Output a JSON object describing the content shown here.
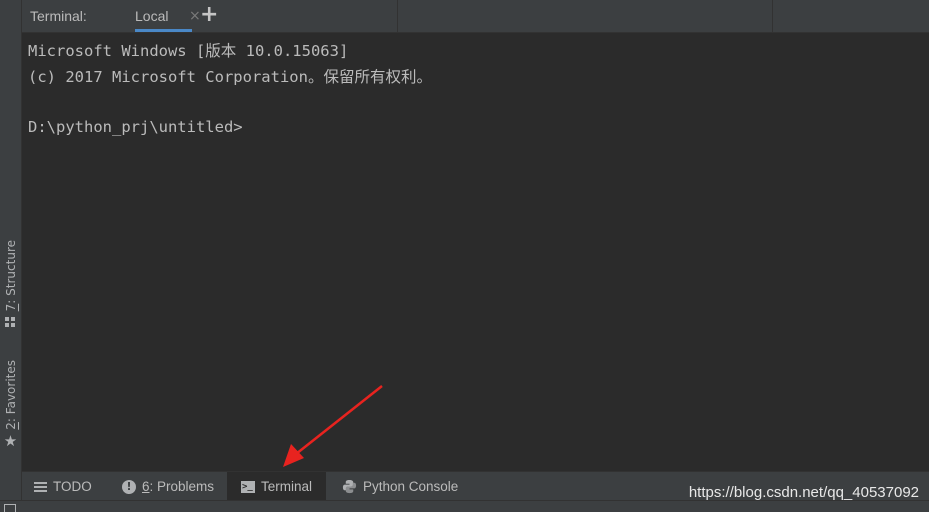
{
  "header": {
    "title": "Terminal:",
    "tabs": [
      {
        "label": "Local",
        "active": true
      }
    ],
    "close_glyph": "×",
    "add_glyph": "+"
  },
  "terminal": {
    "lines": [
      "Microsoft Windows [版本 10.0.15063]",
      "(c) 2017 Microsoft Corporation。保留所有权利。",
      "",
      "D:\\python_prj\\untitled>"
    ]
  },
  "left_stripe": {
    "structure": {
      "mnemonic": "7",
      "label": ": Structure"
    },
    "favorites": {
      "mnemonic": "2",
      "label": ": Favorites"
    }
  },
  "bottom_tabs": {
    "todo": "TODO",
    "problems_mnemonic": "6",
    "problems_label": ": Problems",
    "terminal": "Terminal",
    "python_console": "Python Console"
  },
  "watermark": "https://blog.csdn.net/qq_40537092",
  "colors": {
    "background": "#2b2b2b",
    "panel": "#3c3f41",
    "text": "#bbbbbb",
    "accent": "#4a88c7",
    "arrow": "#e8231f"
  }
}
